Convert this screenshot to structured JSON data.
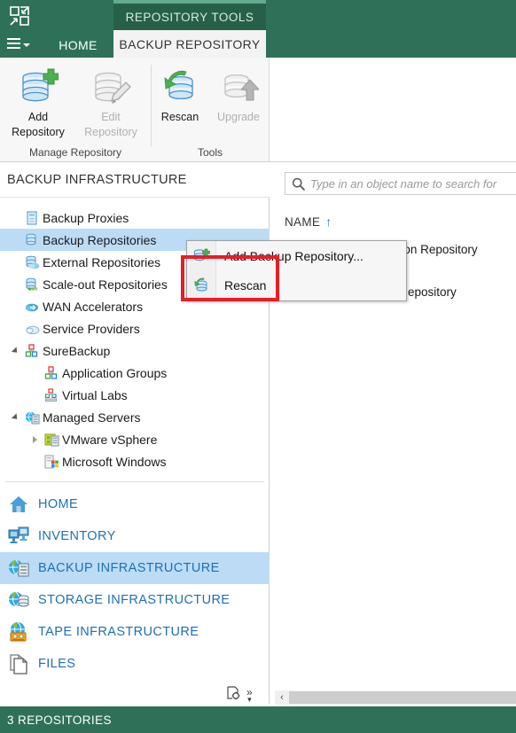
{
  "window": {
    "app_icon": "collapse-arrows-icon",
    "menu_icon": "hamburger-menu-icon"
  },
  "ribbon": {
    "contextual_group": "REPOSITORY TOOLS",
    "tabs": [
      {
        "label": "HOME",
        "active": false
      },
      {
        "label": "BACKUP REPOSITORY",
        "active": true
      }
    ],
    "groups": [
      {
        "title": "Manage Repository",
        "buttons": [
          {
            "label_line1": "Add",
            "label_line2": "Repository",
            "icon": "add-repository-icon",
            "disabled": false
          },
          {
            "label_line1": "Edit",
            "label_line2": "Repository",
            "icon": "edit-repository-icon",
            "disabled": true
          }
        ]
      },
      {
        "title": "Tools",
        "buttons": [
          {
            "label_line1": "Rescan",
            "label_line2": "",
            "icon": "rescan-icon",
            "disabled": false
          },
          {
            "label_line1": "Upgrade",
            "label_line2": "",
            "icon": "upgrade-icon",
            "disabled": true
          }
        ]
      }
    ]
  },
  "left_pane": {
    "title": "BACKUP INFRASTRUCTURE",
    "tree": [
      {
        "label": "Backup Proxies",
        "icon": "backup-proxy-icon",
        "indent": 0,
        "expander": "none",
        "selected": false
      },
      {
        "label": "Backup Repositories",
        "icon": "backup-repository-icon",
        "indent": 0,
        "expander": "none",
        "selected": true
      },
      {
        "label": "External Repositories",
        "icon": "external-repository-icon",
        "indent": 0,
        "expander": "none",
        "selected": false
      },
      {
        "label": "Scale-out Repositories",
        "icon": "scaleout-repository-icon",
        "indent": 0,
        "expander": "none",
        "selected": false
      },
      {
        "label": "WAN Accelerators",
        "icon": "wan-accelerator-icon",
        "indent": 0,
        "expander": "none",
        "selected": false
      },
      {
        "label": "Service Providers",
        "icon": "service-provider-icon",
        "indent": 0,
        "expander": "none",
        "selected": false
      },
      {
        "label": "SureBackup",
        "icon": "surebackup-icon",
        "indent": 0,
        "expander": "open",
        "selected": false
      },
      {
        "label": "Application Groups",
        "icon": "application-group-icon",
        "indent": 1,
        "expander": "none",
        "selected": false
      },
      {
        "label": "Virtual Labs",
        "icon": "virtual-lab-icon",
        "indent": 1,
        "expander": "none",
        "selected": false
      },
      {
        "label": "Managed Servers",
        "icon": "managed-server-icon",
        "indent": 0,
        "expander": "open",
        "selected": false
      },
      {
        "label": "VMware vSphere",
        "icon": "vmware-vsphere-icon",
        "indent": 1,
        "expander": "closed",
        "selected": false
      },
      {
        "label": "Microsoft Windows",
        "icon": "microsoft-windows-icon",
        "indent": 1,
        "expander": "none",
        "selected": false
      }
    ]
  },
  "nav": {
    "items": [
      {
        "label": "HOME",
        "icon": "home-icon",
        "selected": false
      },
      {
        "label": "INVENTORY",
        "icon": "inventory-icon",
        "selected": false
      },
      {
        "label": "BACKUP INFRASTRUCTURE",
        "icon": "backup-infrastructure-icon",
        "selected": true
      },
      {
        "label": "STORAGE INFRASTRUCTURE",
        "icon": "storage-infrastructure-icon",
        "selected": false
      },
      {
        "label": "TAPE INFRASTRUCTURE",
        "icon": "tape-infrastructure-icon",
        "selected": false
      },
      {
        "label": "FILES",
        "icon": "files-icon",
        "selected": false
      }
    ],
    "config_icon": "configure-navigation-icon",
    "overflow_icon": "more-chevrons-icon"
  },
  "right_pane": {
    "search": {
      "placeholder": "Type in an object name to search for",
      "value": "",
      "icon": "search-icon"
    },
    "column_header": "NAME",
    "sort_indicator": "↑",
    "rows": [
      {
        "name": "BackupConfiguration Repository",
        "icon": "repository-icon"
      },
      {
        "name": "epository",
        "icon": "repository-icon"
      }
    ]
  },
  "context_menu": {
    "items": [
      {
        "label": "Add Backup Repository...",
        "icon": "add-repository-icon",
        "highlighted": false
      },
      {
        "label": "Rescan",
        "icon": "rescan-icon",
        "highlighted": true
      }
    ],
    "highlight_color": "#ec1c24"
  },
  "scrollbar": {
    "left_arrow": "‹"
  },
  "statusbar": {
    "text": "3 REPOSITORIES"
  },
  "colors": {
    "brand_green": "#2e7158",
    "brand_green_dark": "#276048",
    "brand_green_light": "#63ab8e",
    "selection_blue": "#bcdcf5",
    "nav_text_blue": "#1f6fb5",
    "annotation_red": "#ec1c24"
  }
}
